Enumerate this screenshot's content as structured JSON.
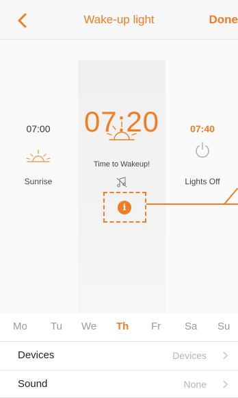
{
  "header": {
    "title": "Wake-up light",
    "done_label": "Done",
    "accent": "#f07c23"
  },
  "timeline": {
    "left": {
      "time": "07:00",
      "label": "Sunrise",
      "icon": "sunrise-icon"
    },
    "center": {
      "time": "07:20",
      "label": "Time to Wakeup!",
      "icon": "sun-icon",
      "sound_icon": "music-muted-icon",
      "info_icon": "info-icon"
    },
    "right": {
      "time": "07:40",
      "label": "Lights Off",
      "icon": "power-icon"
    }
  },
  "weekdays": [
    {
      "label": "Mo",
      "active": false
    },
    {
      "label": "Tu",
      "active": false
    },
    {
      "label": "We",
      "active": false
    },
    {
      "label": "Th",
      "active": true
    },
    {
      "label": "Fr",
      "active": false
    },
    {
      "label": "Sa",
      "active": false
    },
    {
      "label": "Su",
      "active": false
    }
  ],
  "settings": [
    {
      "label": "Devices",
      "value": "Devices"
    },
    {
      "label": "Sound",
      "value": "None"
    }
  ]
}
